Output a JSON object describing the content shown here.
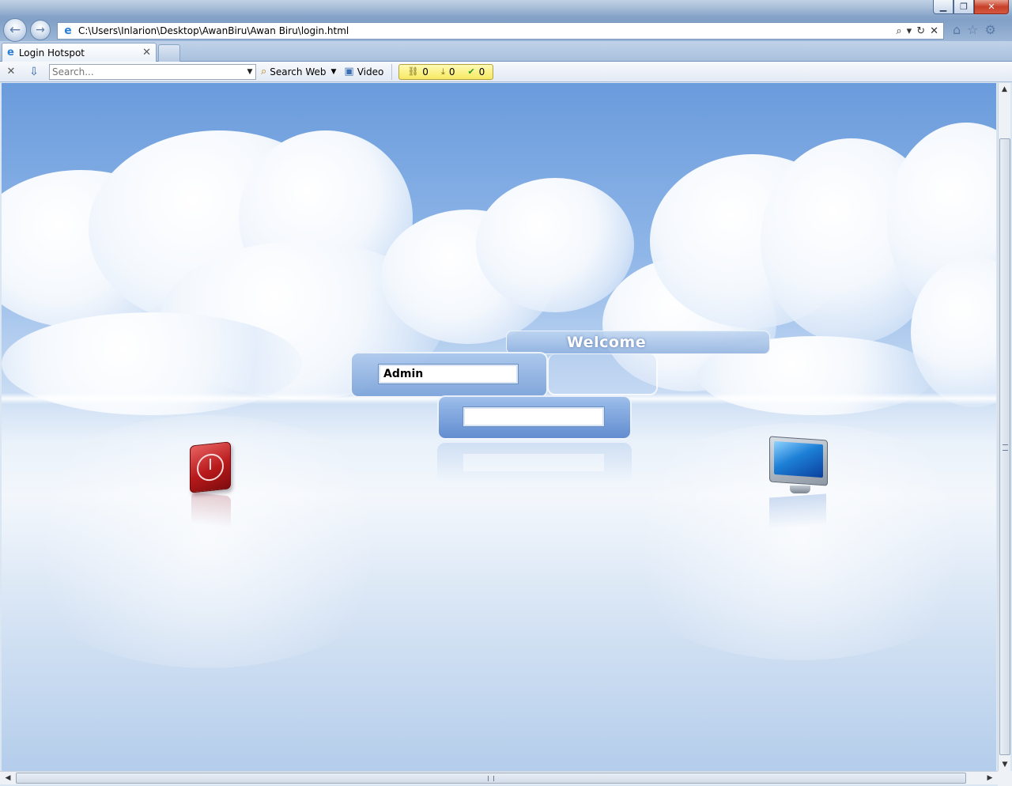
{
  "window": {
    "buttons": {
      "minimize": "▁",
      "restore": "❐",
      "close": "✕"
    }
  },
  "nav": {
    "back_icon": "←",
    "forward_icon": "→"
  },
  "address_bar": {
    "url": "C:\\Users\\Inlarion\\Desktop\\AwanBiru\\Awan Biru\\login.html",
    "tools": [
      "⌕",
      "▾",
      "↻",
      "✕"
    ]
  },
  "right_icons": [
    "⌂",
    "☆",
    "⚙"
  ],
  "tabs": [
    {
      "title": "Login Hotspot",
      "close": "✕"
    }
  ],
  "toolbar": {
    "close_icon": "✕",
    "download_icon": "⇩",
    "search_placeholder": "Search...",
    "search_web_label": "Search Web",
    "video_label": "Video",
    "counters": [
      {
        "icon": "link-icon",
        "value": "0"
      },
      {
        "icon": "download-icon",
        "value": "0"
      },
      {
        "icon": "check-icon",
        "value": "0"
      }
    ]
  },
  "login": {
    "welcome": "Welcome",
    "username_value": "Admin",
    "password_value": ""
  },
  "colors": {
    "sky_top": "#6a9bdc",
    "power_red": "#b8191b",
    "monitor_blue": "#1d7fd6",
    "counter_yellow": "#f6e862"
  }
}
